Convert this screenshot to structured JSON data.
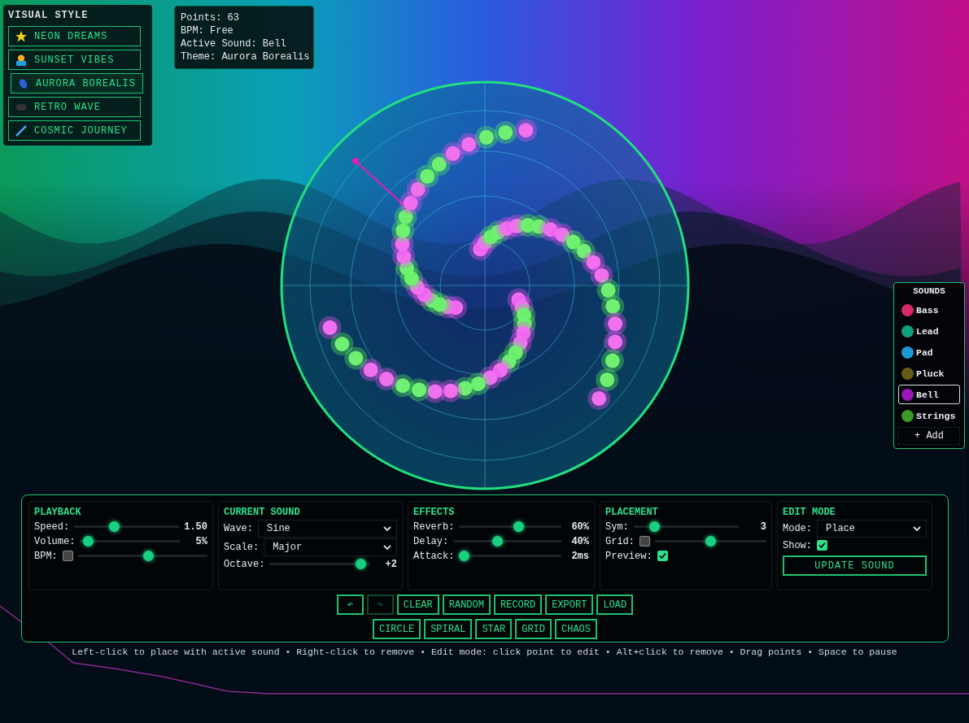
{
  "visual_style": {
    "title": "VISUAL STYLE",
    "items": [
      {
        "label": "NEON DREAMS",
        "selected": false
      },
      {
        "label": "SUNSET VIBES",
        "selected": false
      },
      {
        "label": "AURORA BOREALIS",
        "selected": true
      },
      {
        "label": "RETRO WAVE",
        "selected": false
      },
      {
        "label": "COSMIC JOURNEY",
        "selected": false
      }
    ]
  },
  "info": [
    "Points: 63",
    "BPM: Free",
    "Active Sound: Bell",
    "Theme: Aurora Borealis"
  ],
  "sounds": {
    "title": "SOUNDS",
    "items": [
      {
        "label": "Bass",
        "selected": false,
        "color": "#d8286a"
      },
      {
        "label": "Lead",
        "selected": false,
        "color": "#12a07e"
      },
      {
        "label": "Pad",
        "selected": false,
        "color": "#1a9ad0"
      },
      {
        "label": "Pluck",
        "selected": false,
        "color": "#6a5a18"
      },
      {
        "label": "Bell",
        "selected": true,
        "color": "#9a18b8"
      },
      {
        "label": "Strings",
        "selected": false,
        "color": "#3a9a2a"
      }
    ],
    "add_button": "+ Add"
  },
  "sections": [
    {
      "title": "PLAYBACK",
      "rows": [
        {
          "kind": "slider",
          "label": "Speed:",
          "level": 0.37,
          "reading": "1.50"
        },
        {
          "kind": "slider",
          "label": "Volume:",
          "level": 0.03,
          "reading": "5%"
        },
        {
          "kind": "checkslider",
          "label": "BPM:",
          "checked": false,
          "level": 0.55
        }
      ]
    },
    {
      "title": "CURRENT SOUND",
      "rows": [
        {
          "kind": "select",
          "label": "Wave:",
          "value": "Sine"
        },
        {
          "kind": "select",
          "label": "Scale:",
          "value": "Major"
        },
        {
          "kind": "slider",
          "label": "Octave:",
          "level": 0.97,
          "reading": "+2"
        }
      ]
    },
    {
      "title": "EFFECTS",
      "rows": [
        {
          "kind": "slider",
          "label": "Reverb:",
          "level": 0.6,
          "reading": "60%"
        },
        {
          "kind": "slider",
          "label": "Delay:",
          "level": 0.4,
          "reading": "40%"
        },
        {
          "kind": "slider",
          "label": "Attack:",
          "level": 0.0,
          "reading": "2ms"
        }
      ]
    },
    {
      "title": "PLACEMENT",
      "rows": [
        {
          "kind": "slider",
          "label": "Sym:",
          "level": 0.17,
          "reading": "3"
        },
        {
          "kind": "checkslider",
          "label": "Grid:",
          "checked": false,
          "level": 0.5
        },
        {
          "kind": "checkbox",
          "label": "Preview:",
          "checked": true
        }
      ]
    },
    {
      "title": "EDIT MODE",
      "rows": [
        {
          "kind": "select",
          "label": "Mode:",
          "value": "Place"
        },
        {
          "kind": "checkbox",
          "label": "Show:",
          "checked": true
        },
        {
          "kind": "button",
          "label": "UPDATE SOUND"
        }
      ]
    }
  ],
  "toolbar": [
    [
      {
        "label": "↶",
        "disabled": false
      },
      {
        "label": "↷",
        "disabled": true
      },
      {
        "label": "CLEAR",
        "disabled": false
      },
      {
        "label": "RANDOM",
        "disabled": false
      },
      {
        "label": "RECORD",
        "disabled": false
      },
      {
        "label": "EXPORT",
        "disabled": false
      },
      {
        "label": "LOAD",
        "disabled": false
      }
    ],
    [
      {
        "label": "CIRCLE",
        "disabled": false
      },
      {
        "label": "SPIRAL",
        "disabled": false
      },
      {
        "label": "STAR",
        "disabled": false
      },
      {
        "label": "GRID",
        "disabled": false
      },
      {
        "label": "CHAOS",
        "disabled": false
      }
    ]
  ],
  "hint": "Left-click to place with active sound • Right-click to remove • Edit mode: click point to edit • Alt+click to remove • Drag points • Space to pause"
}
